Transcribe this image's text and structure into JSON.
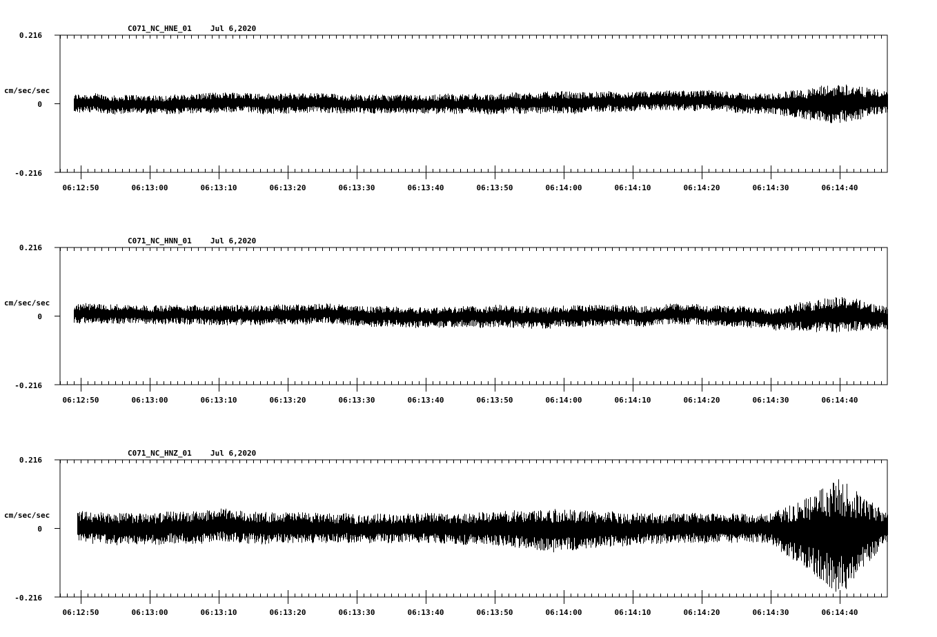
{
  "chart_data": [
    {
      "type": "line",
      "title": "C071_NC_HNE_01",
      "date": "Jul 6,2020",
      "ylabel": "cm/sec/sec",
      "ylim": [
        -0.216,
        0.216
      ],
      "yticks": [
        "0.216",
        "0",
        "-0.216"
      ],
      "xticks": [
        "06:12:50",
        "06:13:00",
        "06:13:10",
        "06:13:20",
        "06:13:30",
        "06:13:40",
        "06:13:50",
        "06:14:00",
        "06:14:10",
        "06:14:20",
        "06:14:30",
        "06:14:40"
      ],
      "series": [
        {
          "x_seconds_start": "06:12:49",
          "envelope": [
            {
              "t": "06:12:49",
              "min": -0.03,
              "max": 0.03
            },
            {
              "t": "06:13:00",
              "min": -0.035,
              "max": 0.025
            },
            {
              "t": "06:13:10",
              "min": -0.03,
              "max": 0.035
            },
            {
              "t": "06:13:20",
              "min": -0.03,
              "max": 0.035
            },
            {
              "t": "06:13:30",
              "min": -0.03,
              "max": 0.03
            },
            {
              "t": "06:13:40",
              "min": -0.03,
              "max": 0.03
            },
            {
              "t": "06:13:50",
              "min": -0.035,
              "max": 0.03
            },
            {
              "t": "06:14:00",
              "min": -0.03,
              "max": 0.04
            },
            {
              "t": "06:14:10",
              "min": -0.025,
              "max": 0.035
            },
            {
              "t": "06:14:20",
              "min": -0.025,
              "max": 0.04
            },
            {
              "t": "06:14:30",
              "min": -0.035,
              "max": 0.03
            },
            {
              "t": "06:14:40",
              "min": -0.06,
              "max": 0.07
            },
            {
              "t": "06:14:47",
              "min": -0.03,
              "max": 0.035
            }
          ]
        }
      ]
    },
    {
      "type": "line",
      "title": "C071_NC_HNN_01",
      "date": "Jul 6,2020",
      "ylabel": "cm/sec/sec",
      "ylim": [
        -0.216,
        0.216
      ],
      "yticks": [
        "0.216",
        "0",
        "-0.216"
      ],
      "xticks": [
        "06:12:50",
        "06:13:00",
        "06:13:10",
        "06:13:20",
        "06:13:30",
        "06:13:40",
        "06:13:50",
        "06:14:00",
        "06:14:10",
        "06:14:20",
        "06:14:30",
        "06:14:40"
      ],
      "series": [
        {
          "x_seconds_start": "06:12:49",
          "envelope": [
            {
              "t": "06:12:49",
              "min": -0.025,
              "max": 0.04
            },
            {
              "t": "06:13:00",
              "min": -0.025,
              "max": 0.035
            },
            {
              "t": "06:13:10",
              "min": -0.03,
              "max": 0.035
            },
            {
              "t": "06:13:20",
              "min": -0.025,
              "max": 0.04
            },
            {
              "t": "06:13:30",
              "min": -0.03,
              "max": 0.035
            },
            {
              "t": "06:13:40",
              "min": -0.035,
              "max": 0.03
            },
            {
              "t": "06:13:50",
              "min": -0.035,
              "max": 0.035
            },
            {
              "t": "06:14:00",
              "min": -0.035,
              "max": 0.035
            },
            {
              "t": "06:14:10",
              "min": -0.03,
              "max": 0.035
            },
            {
              "t": "06:14:20",
              "min": -0.03,
              "max": 0.035
            },
            {
              "t": "06:14:30",
              "min": -0.04,
              "max": 0.03
            },
            {
              "t": "06:14:40",
              "min": -0.05,
              "max": 0.07
            },
            {
              "t": "06:14:47",
              "min": -0.04,
              "max": 0.03
            }
          ]
        }
      ]
    },
    {
      "type": "line",
      "title": "C071_NC_HNZ_01",
      "date": "Jul 6,2020",
      "ylabel": "cm/sec/sec",
      "ylim": [
        -0.216,
        0.216
      ],
      "yticks": [
        "0.216",
        "0",
        "-0.216"
      ],
      "xticks": [
        "06:12:50",
        "06:13:00",
        "06:13:10",
        "06:13:20",
        "06:13:30",
        "06:13:40",
        "06:13:50",
        "06:14:00",
        "06:14:10",
        "06:14:20",
        "06:14:30",
        "06:14:40"
      ],
      "series": [
        {
          "x_seconds_start": "06:12:49.5",
          "envelope": [
            {
              "t": "06:12:49.5",
              "min": -0.045,
              "max": 0.055
            },
            {
              "t": "06:13:00",
              "min": -0.05,
              "max": 0.05
            },
            {
              "t": "06:13:10",
              "min": -0.045,
              "max": 0.06
            },
            {
              "t": "06:13:20",
              "min": -0.05,
              "max": 0.05
            },
            {
              "t": "06:13:30",
              "min": -0.045,
              "max": 0.045
            },
            {
              "t": "06:13:40",
              "min": -0.045,
              "max": 0.05
            },
            {
              "t": "06:13:50",
              "min": -0.05,
              "max": 0.055
            },
            {
              "t": "06:13:58",
              "min": -0.075,
              "max": 0.065
            },
            {
              "t": "06:14:10",
              "min": -0.05,
              "max": 0.05
            },
            {
              "t": "06:14:20",
              "min": -0.045,
              "max": 0.05
            },
            {
              "t": "06:14:30",
              "min": -0.045,
              "max": 0.05
            },
            {
              "t": "06:14:40",
              "min": -0.21,
              "max": 0.16
            },
            {
              "t": "06:14:47",
              "min": -0.04,
              "max": 0.045
            }
          ]
        }
      ]
    }
  ]
}
